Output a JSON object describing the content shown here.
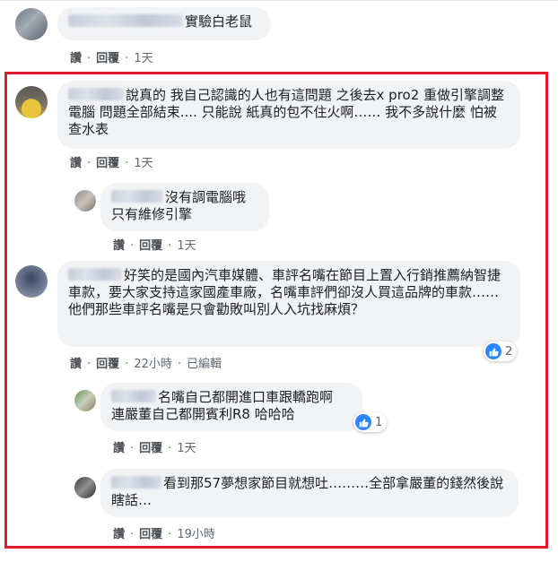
{
  "actions": {
    "like": "讚",
    "reply": "回覆",
    "sep": "·"
  },
  "comments": [
    {
      "text": "實驗白老鼠",
      "time": "1天"
    },
    {
      "text": "說真的 我自己認識的人也有這問題 之後去x pro2 重做引擎調整電腦 問題全部結束.... 只能說 紙真的包不住火啊…… 我不多說什麼 怕被查水表",
      "time": "1天"
    },
    {
      "text": "沒有調電腦哦\n只有維修引擎",
      "time": "1天"
    },
    {
      "text": "好笑的是國內汽車媒體、車評名嘴在節目上置入行銷推薦納智捷車款，要大家支持這家國產車廠，名嘴車評們卻沒人買這品牌的車款……\n他們那些車評名嘴是只會勸敗叫別人入坑找麻煩？",
      "time": "22小時",
      "edited": "已編輯",
      "likes": "2"
    },
    {
      "text": "名嘴自己都開進口車跟轎跑啊\n連嚴董自己都開賓利R8 哈哈哈",
      "time": "1天",
      "likes": "1"
    },
    {
      "text": "看到那57夢想家節目就想吐………全部拿嚴董的錢然後說瞎話…",
      "time": "19小時"
    }
  ],
  "colors": {
    "frame": "#e21b2a",
    "like_blue": "#2d86ff",
    "bubble": "#f2f3f5"
  }
}
